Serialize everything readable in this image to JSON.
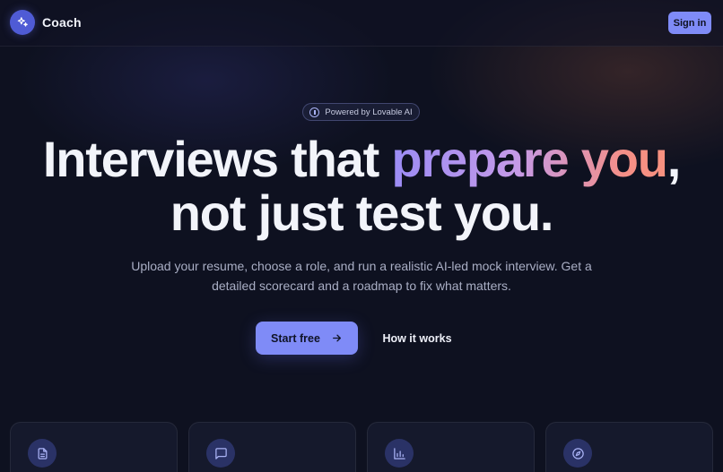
{
  "header": {
    "logo_text": "Coach",
    "logo_icon": "sparkles-icon",
    "signin_label": "Sign in"
  },
  "hero": {
    "badge": "Powered by Lovable AI",
    "badge_icon": "brain-icon",
    "headline_part1": "Interviews that ",
    "headline_highlight": "prepare you",
    "headline_comma": ",",
    "headline_line2": "not just test you.",
    "subtitle": "Upload your resume, choose a role, and run a realistic AI-led mock interview. Get a detailed scorecard and a roadmap to fix what matters.",
    "primary_cta": "Start free",
    "primary_cta_icon": "arrow-right-icon",
    "secondary_cta": "How it works"
  },
  "features": [
    {
      "icon": "file-text-icon"
    },
    {
      "icon": "message-square-icon"
    },
    {
      "icon": "bar-chart-icon"
    },
    {
      "icon": "compass-icon"
    }
  ],
  "colors": {
    "background": "#0e1120",
    "accent": "#7f8bf7",
    "gradient_start": "#9b8cf5",
    "gradient_end": "#f7917f"
  }
}
